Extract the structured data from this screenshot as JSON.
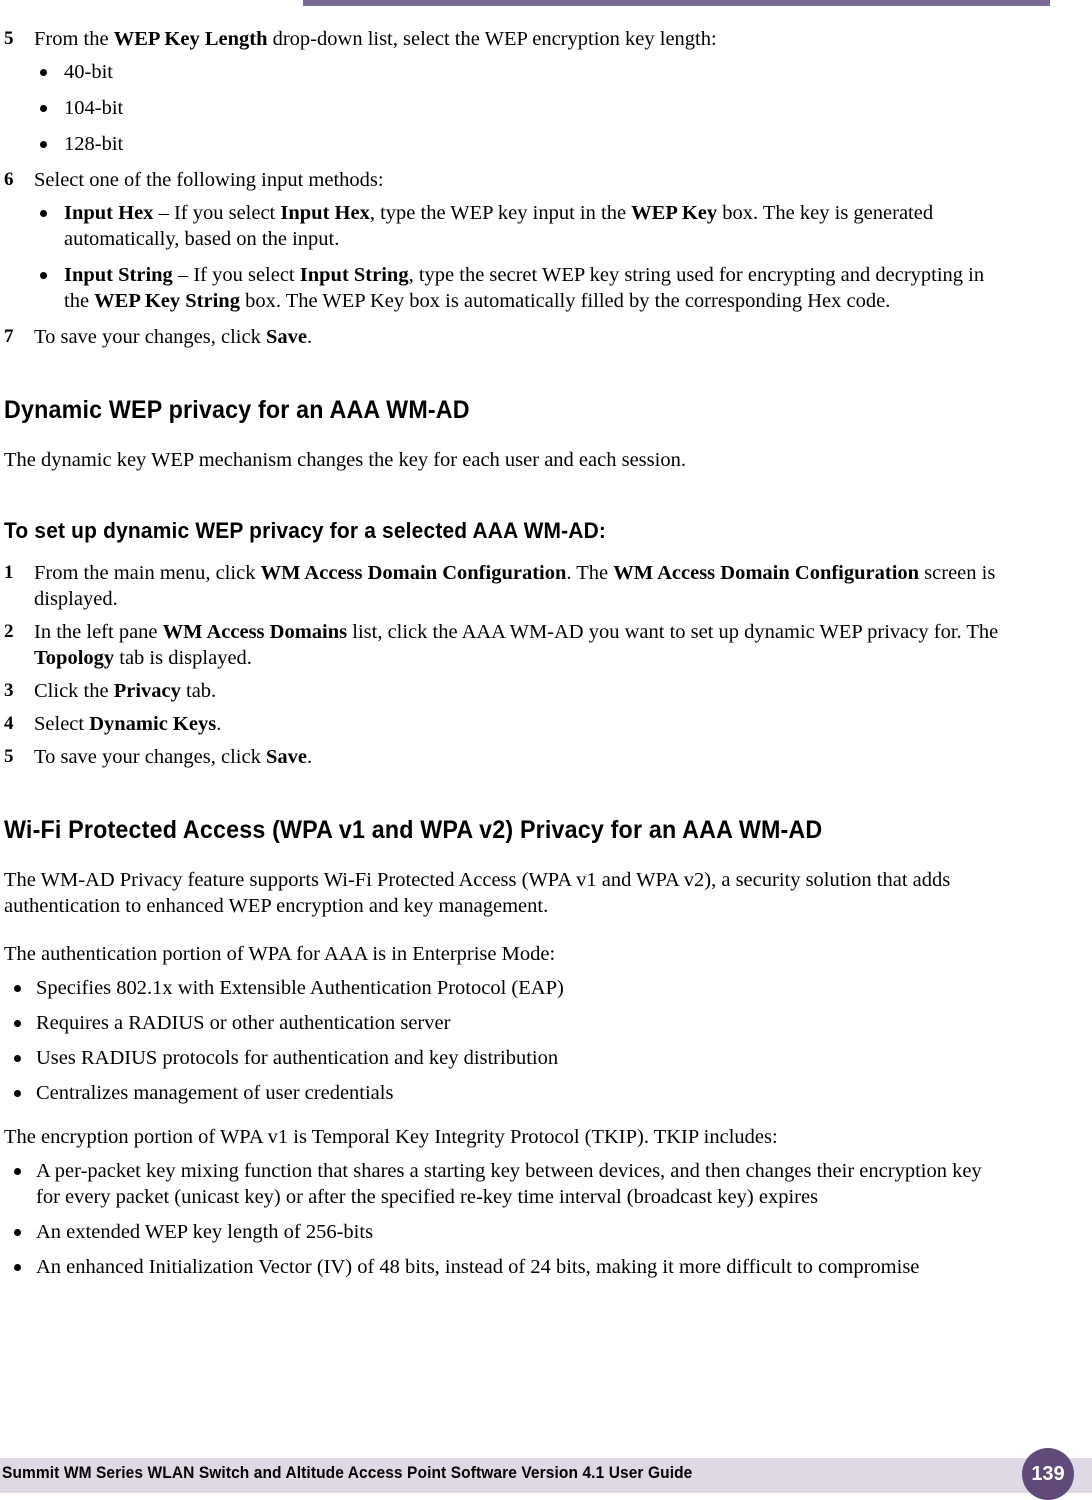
{
  "page": {
    "number": "139",
    "footer_title": "Summit WM Series WLAN Switch and Altitude Access Point Software Version 4.1 User Guide",
    "accent_color": "#7a6a96",
    "footer_band_color": "#ded9e4",
    "badge_color": "#614a7a"
  },
  "content": {
    "step5": {
      "number": "5",
      "text_pre": "From the ",
      "bold1": "WEP Key Length",
      "text_post": " drop-down list, select the WEP encryption key length:"
    },
    "step5_bullets": [
      {
        "label": "40-bit"
      },
      {
        "label": "104-bit"
      },
      {
        "label": "128-bit"
      }
    ],
    "step6": {
      "number": "6",
      "text": "Select one of the following input methods:"
    },
    "step6_bullets": [
      {
        "b1": "Input Hex",
        "t1": " – If you select ",
        "b2": "Input Hex",
        "t2": ", type the WEP key input in the ",
        "b3": "WEP Key",
        "t3": " box. The key is generated automatically, based on the input."
      },
      {
        "b1": "Input String",
        "t1": " – If you select ",
        "b2": "Input String",
        "t2": ", type the secret WEP key string used for encrypting and decrypting in the ",
        "b3": "WEP Key String",
        "t3": " box. The WEP Key box is automatically filled by the corresponding Hex code."
      }
    ],
    "step7": {
      "number": "7",
      "text_pre": "To save your changes, click ",
      "bold1": "Save",
      "text_post": "."
    },
    "heading_dynamic_wep": "Dynamic WEP privacy for an AAA WM-AD",
    "para_dynamic_wep": "The dynamic key WEP mechanism changes the key for each user and each session.",
    "heading_setup_dynamic": "To set up dynamic WEP privacy for a selected AAA WM-AD:",
    "setup_steps": [
      {
        "number": "1",
        "t1": "From the main menu, click ",
        "b1": "WM Access Domain Configuration",
        "t2": ". The ",
        "b2": "WM Access Domain Configuration",
        "t3": " screen is displayed."
      },
      {
        "number": "2",
        "t1": "In the left pane ",
        "b1": "WM Access Domains",
        "t2": " list, click the AAA WM-AD you want to set up dynamic WEP privacy for. The ",
        "b2": "Topology",
        "t3": " tab is displayed."
      },
      {
        "number": "3",
        "t1": "Click the ",
        "b1": "Privacy",
        "t2": " tab.",
        "b2": "",
        "t3": ""
      },
      {
        "number": "4",
        "t1": "Select ",
        "b1": "Dynamic Keys",
        "t2": ".",
        "b2": "",
        "t3": ""
      },
      {
        "number": "5",
        "t1": "To save your changes, click ",
        "b1": "Save",
        "t2": ".",
        "b2": "",
        "t3": ""
      }
    ],
    "heading_wpa": "Wi-Fi Protected Access (WPA v1 and WPA v2) Privacy for an AAA WM-AD",
    "para_wpa_1": "The WM-AD Privacy feature supports Wi-Fi Protected Access (WPA v1 and WPA v2), a security solution that adds authentication to enhanced WEP encryption and key management.",
    "para_wpa_2": "The authentication portion of WPA for AAA is in Enterprise Mode:",
    "wpa_enterprise_bullets": [
      "Specifies 802.1x with Extensible Authentication Protocol (EAP)",
      "Requires a RADIUS or other authentication server",
      "Uses RADIUS protocols for authentication and key distribution",
      "Centralizes management of user credentials"
    ],
    "para_tkip": "The encryption portion of WPA v1 is Temporal Key Integrity Protocol (TKIP). TKIP includes:",
    "tkip_bullets": [
      "A per-packet key mixing function that shares a starting key between devices, and then changes their encryption key for every packet (unicast key) or after the specified re-key time interval (broadcast key) expires",
      "An extended WEP key length of 256-bits",
      "An enhanced Initialization Vector (IV) of 48 bits, instead of 24 bits, making it more difficult to compromise"
    ]
  }
}
